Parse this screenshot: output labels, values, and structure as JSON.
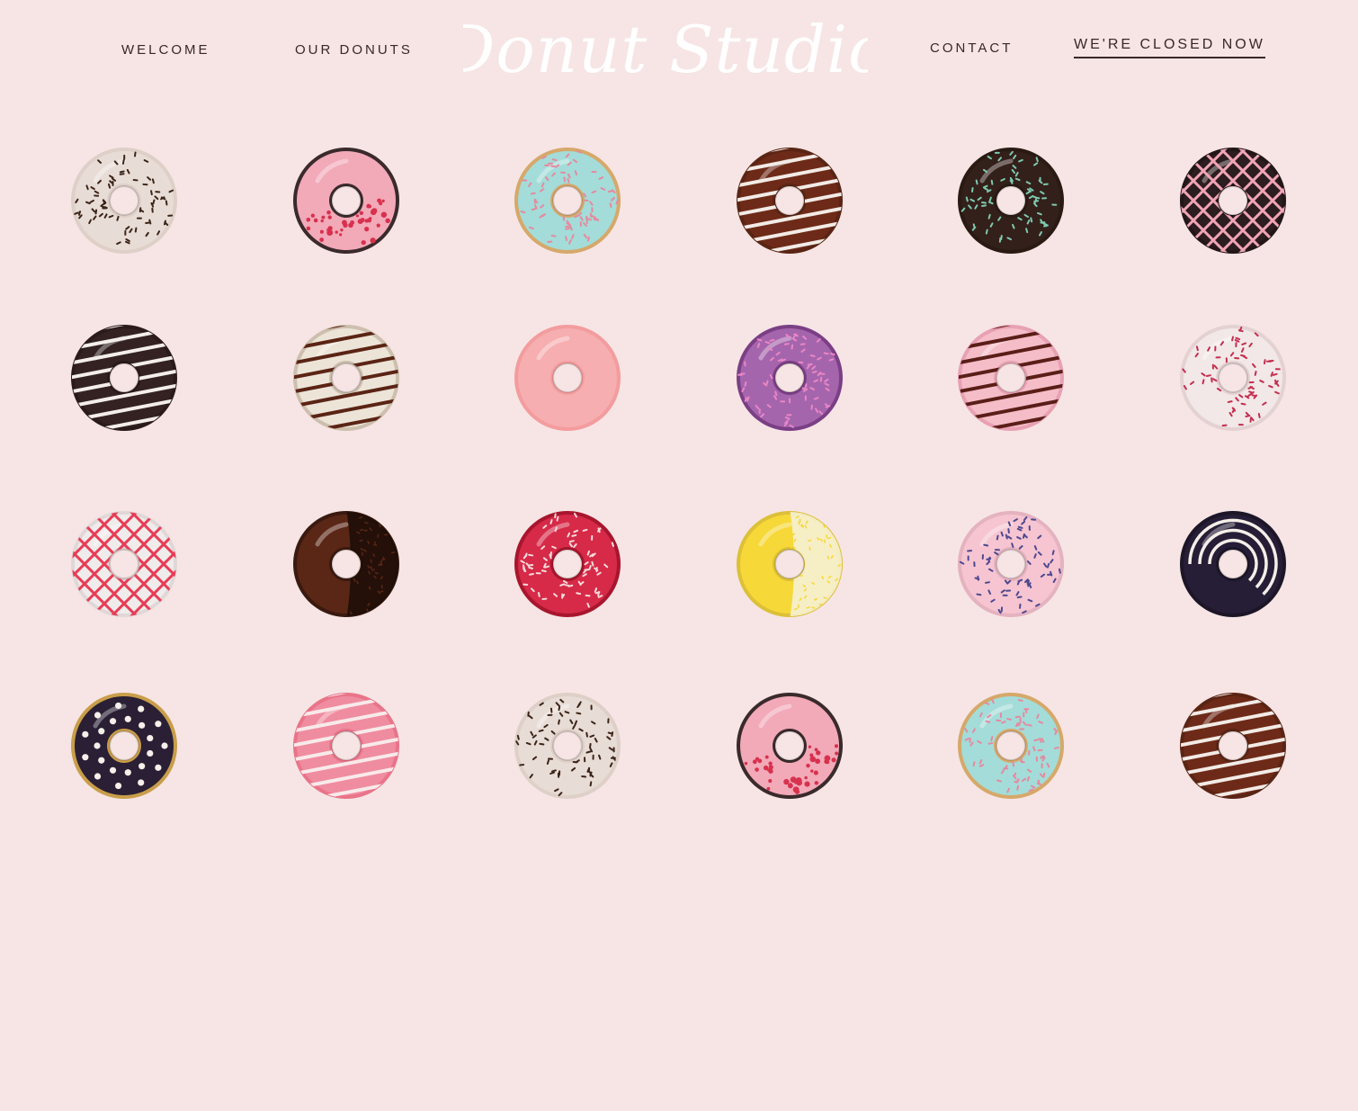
{
  "nav": {
    "welcome": "WELCOME",
    "our_donuts": "OUR DONUTS",
    "contact": "CONTACT",
    "status": "WE'RE CLOSED NOW"
  },
  "brand": {
    "logo_text": "Donut Studio"
  },
  "colors": {
    "background": "#f6e5e4",
    "nav_text": "#3a2626",
    "logo": "#ffffff"
  },
  "donuts": [
    {
      "icon": "vanilla-chocolate-sprinkles-donut-icon",
      "base": "#ded0c8",
      "glaze": "#e8dcd6",
      "topping": "sprinkles",
      "topping_color": "#3b2418"
    },
    {
      "icon": "pink-raspberry-donut-icon",
      "base": "#3a2a2c",
      "glaze": "#f2a9b8",
      "topping": "crumbs",
      "topping_color": "#d8314e"
    },
    {
      "icon": "mint-sprinkles-donut-icon",
      "base": "#d6a86a",
      "glaze": "#a4dcd9",
      "topping": "sprinkles",
      "topping_color": "#e58a9e"
    },
    {
      "icon": "chocolate-white-stripe-donut-icon",
      "base": "#5a2414",
      "glaze": "#6e2a18",
      "topping": "stripes",
      "topping_color": "#f2ebe6"
    },
    {
      "icon": "dark-chocolate-rainbow-sprinkles-donut-icon",
      "base": "#2a1a14",
      "glaze": "#33201a",
      "topping": "sprinkles",
      "topping_color": "#7fc8b0"
    },
    {
      "icon": "dark-chocolate-pink-lattice-donut-icon",
      "base": "#221618",
      "glaze": "#2c1d20",
      "topping": "lattice",
      "topping_color": "#f1a5b6"
    },
    {
      "icon": "dark-chocolate-white-drizzle-donut-icon",
      "base": "#2a1a1a",
      "glaze": "#342223",
      "topping": "stripes",
      "topping_color": "#f4eeea"
    },
    {
      "icon": "vanilla-chocolate-drizzle-donut-icon",
      "base": "#cdbfae",
      "glaze": "#ede4d8",
      "topping": "stripes",
      "topping_color": "#5a2414"
    },
    {
      "icon": "pink-glazed-donut-icon",
      "base": "#f39c9e",
      "glaze": "#f6aeb0",
      "topping": "none",
      "topping_color": "#fbd2d2"
    },
    {
      "icon": "purple-sprinkles-donut-icon",
      "base": "#7b3f85",
      "glaze": "#a565ad",
      "topping": "sprinkles",
      "topping_color": "#e987c5"
    },
    {
      "icon": "pink-chocolate-drizzle-donut-icon",
      "base": "#e8a1b3",
      "glaze": "#f5bdc8",
      "topping": "stripes",
      "topping_color": "#5a1e18"
    },
    {
      "icon": "white-red-sprinkles-donut-icon",
      "base": "#e4d2d2",
      "glaze": "#f2e8e8",
      "topping": "sprinkles",
      "topping_color": "#c52e4e"
    },
    {
      "icon": "white-red-lattice-donut-icon",
      "base": "#e0d8d8",
      "glaze": "#f0eceb",
      "topping": "lattice",
      "topping_color": "#e83c56"
    },
    {
      "icon": "half-chocolate-sprinkles-donut-icon",
      "base": "#3a1a10",
      "glaze": "#5a2616",
      "topping": "half",
      "topping_color": "#1e0e08"
    },
    {
      "icon": "red-glazed-sprinkles-donut-icon",
      "base": "#a8162e",
      "glaze": "#d62a48",
      "topping": "sprinkles",
      "topping_color": "#f5dada"
    },
    {
      "icon": "yellow-coconut-donut-icon",
      "base": "#dcc038",
      "glaze": "#f6d838",
      "topping": "half",
      "topping_color": "#f6f1d4"
    },
    {
      "icon": "pink-lavender-sprinkles-donut-icon",
      "base": "#e5b2c0",
      "glaze": "#f6c5d1",
      "topping": "sprinkles",
      "topping_color": "#4e4890"
    },
    {
      "icon": "dark-swirl-donut-icon",
      "base": "#1c1628",
      "glaze": "#261e36",
      "topping": "swirl",
      "topping_color": "#f4eee8"
    },
    {
      "icon": "dark-pearl-donut-icon",
      "base": "#c99e4a",
      "glaze": "#2a1f34",
      "topping": "pearls",
      "topping_color": "#f4f0ea"
    },
    {
      "icon": "pink-white-stripe-donut-icon",
      "base": "#e9748a",
      "glaze": "#f08ca0",
      "topping": "stripes",
      "topping_color": "#f9eaea"
    },
    {
      "icon": "vanilla-chocolate-sprinkles-donut-icon",
      "base": "#ded0c8",
      "glaze": "#e8dcd6",
      "topping": "sprinkles",
      "topping_color": "#3b2418"
    },
    {
      "icon": "pink-raspberry-donut-icon",
      "base": "#3a2a2c",
      "glaze": "#f2a9b8",
      "topping": "crumbs",
      "topping_color": "#d8314e"
    },
    {
      "icon": "mint-sprinkles-donut-icon",
      "base": "#d6a86a",
      "glaze": "#a4dcd9",
      "topping": "sprinkles",
      "topping_color": "#e58a9e"
    },
    {
      "icon": "chocolate-white-stripe-donut-icon",
      "base": "#5a2414",
      "glaze": "#6e2a18",
      "topping": "stripes",
      "topping_color": "#f2ebe6"
    }
  ]
}
